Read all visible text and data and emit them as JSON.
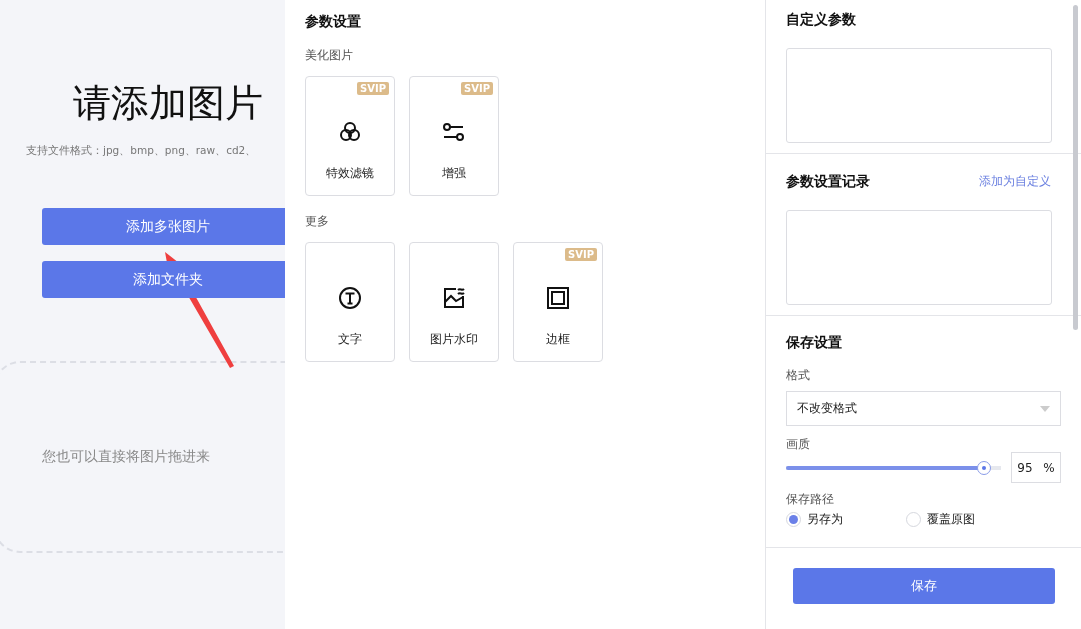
{
  "upload": {
    "title": "请添加图片",
    "formats": "支持文件格式：jpg、bmp、png、raw、cd2、",
    "buttons": [
      "添加多张图片",
      "添加文件夹"
    ],
    "drop_hint": "您也可以直接将图片拖进来"
  },
  "params": {
    "title": "参数设置",
    "groups": [
      {
        "label": "美化图片",
        "tools": [
          {
            "label": "特效滤镜",
            "kind": "filter",
            "badge": "SVIP"
          },
          {
            "label": "增强",
            "kind": "adjust",
            "badge": "SVIP"
          }
        ]
      },
      {
        "label": "更多",
        "tools": [
          {
            "label": "文字",
            "kind": "text"
          },
          {
            "label": "图片水印",
            "kind": "watermark"
          },
          {
            "label": "边框",
            "kind": "frame",
            "badge": "SVIP"
          }
        ]
      }
    ]
  },
  "custom": {
    "title": "自定义参数"
  },
  "history": {
    "title": "参数设置记录",
    "link": "添加为自定义"
  },
  "save_settings": {
    "title": "保存设置",
    "format_label": "格式",
    "format_value": "不改变格式",
    "quality_label": "画质",
    "quality": {
      "level": 0.92,
      "value": "95",
      "unit": "%"
    },
    "path_label": "保存路径",
    "path_options": [
      {
        "label": "另存为",
        "selected": true
      },
      {
        "label": "覆盖原图",
        "selected": false
      }
    ]
  },
  "save_button": "保存"
}
